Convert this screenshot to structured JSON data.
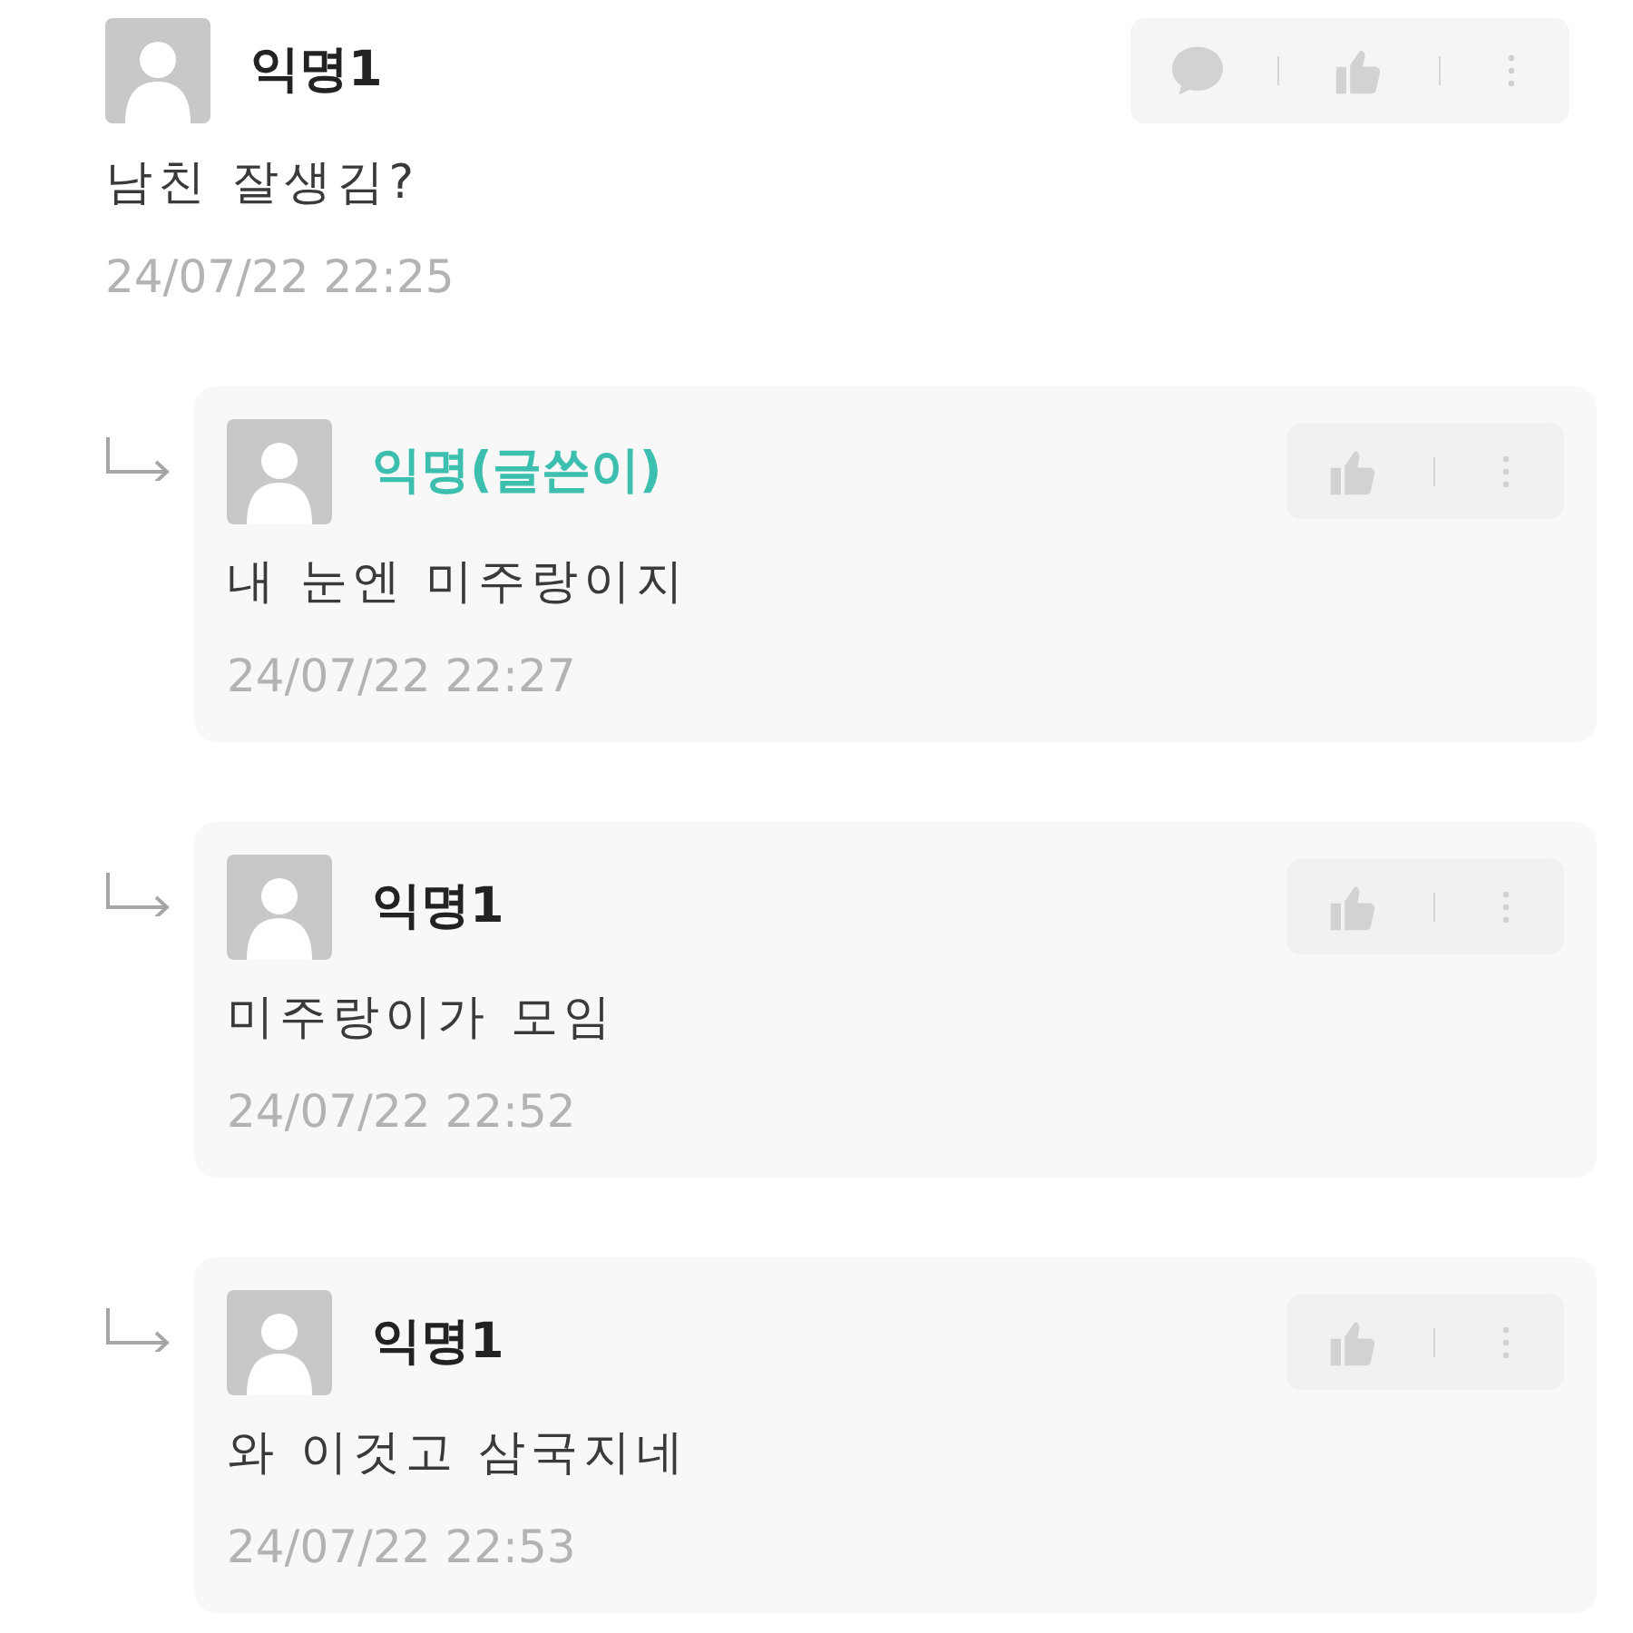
{
  "comment": {
    "author": "익명1",
    "is_writer": false,
    "text": "남친 잘생김?",
    "time": "24/07/22 22:25"
  },
  "replies": [
    {
      "author": "익명(글쓴이)",
      "is_writer": true,
      "text": "내 눈엔 미주랑이지",
      "time": "24/07/22 22:27"
    },
    {
      "author": "익명1",
      "is_writer": false,
      "text": "미주랑이가 모임",
      "time": "24/07/22 22:52"
    },
    {
      "author": "익명1",
      "is_writer": false,
      "text": "와 이것고 삼국지네",
      "time": "24/07/22 22:53"
    }
  ]
}
